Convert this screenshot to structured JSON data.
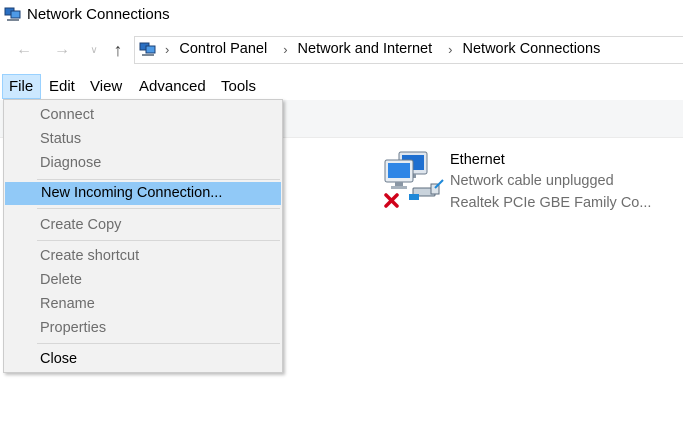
{
  "window": {
    "title": "Network Connections"
  },
  "navigation": {
    "back_glyph": "←",
    "forward_glyph": "→",
    "recent_glyph": "∨",
    "up_glyph": "↑",
    "address_icon": "network-folder-icon",
    "breadcrumb_separator": "›",
    "breadcrumbs": [
      "Control Panel",
      "Network and Internet",
      "Network Connections"
    ]
  },
  "menubar": {
    "items": [
      "File",
      "Edit",
      "View",
      "Advanced",
      "Tools"
    ],
    "active": "File"
  },
  "file_menu": {
    "items": [
      {
        "label": "Connect",
        "enabled": false
      },
      {
        "label": "Status",
        "enabled": false
      },
      {
        "label": "Diagnose",
        "enabled": false
      },
      {
        "label": "New Incoming Connection...",
        "enabled": true,
        "highlighted": true
      },
      {
        "label": "Create Copy",
        "enabled": false
      },
      {
        "label": "Create shortcut",
        "enabled": false
      },
      {
        "label": "Delete",
        "enabled": false
      },
      {
        "label": "Rename",
        "enabled": false
      },
      {
        "label": "Properties",
        "enabled": false
      },
      {
        "label": "Close",
        "enabled": true
      }
    ]
  },
  "adapter": {
    "name": "Ethernet",
    "status": "Network cable unplugged",
    "device": "Realtek PCIe GBE Family Co...",
    "icon": "network-adapter-disconnected-icon"
  },
  "colors": {
    "menu_active_bg": "#cce8ff",
    "menu_highlight_bg": "#91c9f7",
    "disabled_text": "#6d6d6d",
    "error_x": "#d0021b"
  }
}
